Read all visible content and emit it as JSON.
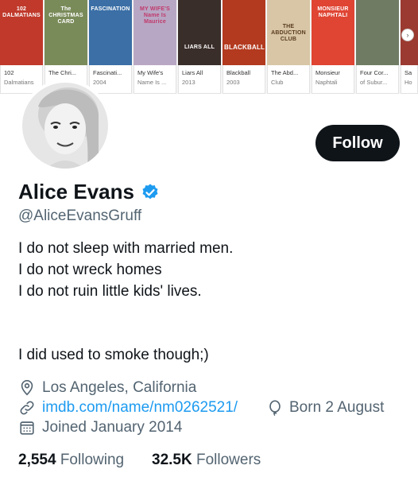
{
  "films": [
    {
      "poster_title": "102 DALMATIANS",
      "name": "102",
      "year": "Dalmatians",
      "color": "#c0392b"
    },
    {
      "poster_title": "The CHRISTMAS CARD",
      "name": "The Chri...",
      "year": "",
      "color": "#7a8b5a"
    },
    {
      "poster_title": "FASCINATION",
      "name": "Fascinati...",
      "year": "2004",
      "color": "#3b6fa6"
    },
    {
      "poster_title": "MY WIFE'S Name Is Maurice",
      "name": "My Wife's",
      "year": "Name Is ...",
      "color": "#b8a7c4"
    },
    {
      "poster_title": "LIARS ALL",
      "name": "Liars All",
      "year": "2013",
      "color": "#3a2e2a"
    },
    {
      "poster_title": "BLACKBALL",
      "name": "Blackball",
      "year": "2003",
      "color": "#b33a1f"
    },
    {
      "poster_title": "THE ABDUCTION CLUB",
      "name": "The Abd...",
      "year": "Club",
      "color": "#d8c6a6"
    },
    {
      "poster_title": "MONSIEUR NAPHTALI",
      "name": "Monsieur",
      "year": "Naphtali",
      "color": "#e04433"
    },
    {
      "poster_title": "",
      "name": "Four Cor...",
      "year": "of Subur...",
      "color": "#6f7c63"
    },
    {
      "poster_title": "",
      "name": "Sa",
      "year": "Ho",
      "color": "#9b3a30"
    }
  ],
  "profile": {
    "follow_label": "Follow",
    "display_name": "Alice Evans",
    "handle": "@AliceEvansGruff",
    "bio": [
      "I do not sleep with married men.",
      "I do not wreck homes",
      "I do not ruin little kids' lives.",
      "I did used to smoke though;)"
    ],
    "location": "Los Angeles, California",
    "website": "imdb.com/name/nm0262521/",
    "birthday": "Born 2 August",
    "joined": "Joined January 2014",
    "following_count": "2,554",
    "following_label": "Following",
    "followers_count": "32.5K",
    "followers_label": "Followers"
  },
  "icons": {
    "verified": "verified-badge-icon",
    "location": "location-pin-icon",
    "link": "link-icon",
    "birthday": "balloon-icon",
    "joined": "calendar-icon"
  },
  "colors": {
    "accent": "#1d9bf0",
    "text": "#0f1419",
    "secondary": "#536471",
    "button": "#0f1419"
  }
}
